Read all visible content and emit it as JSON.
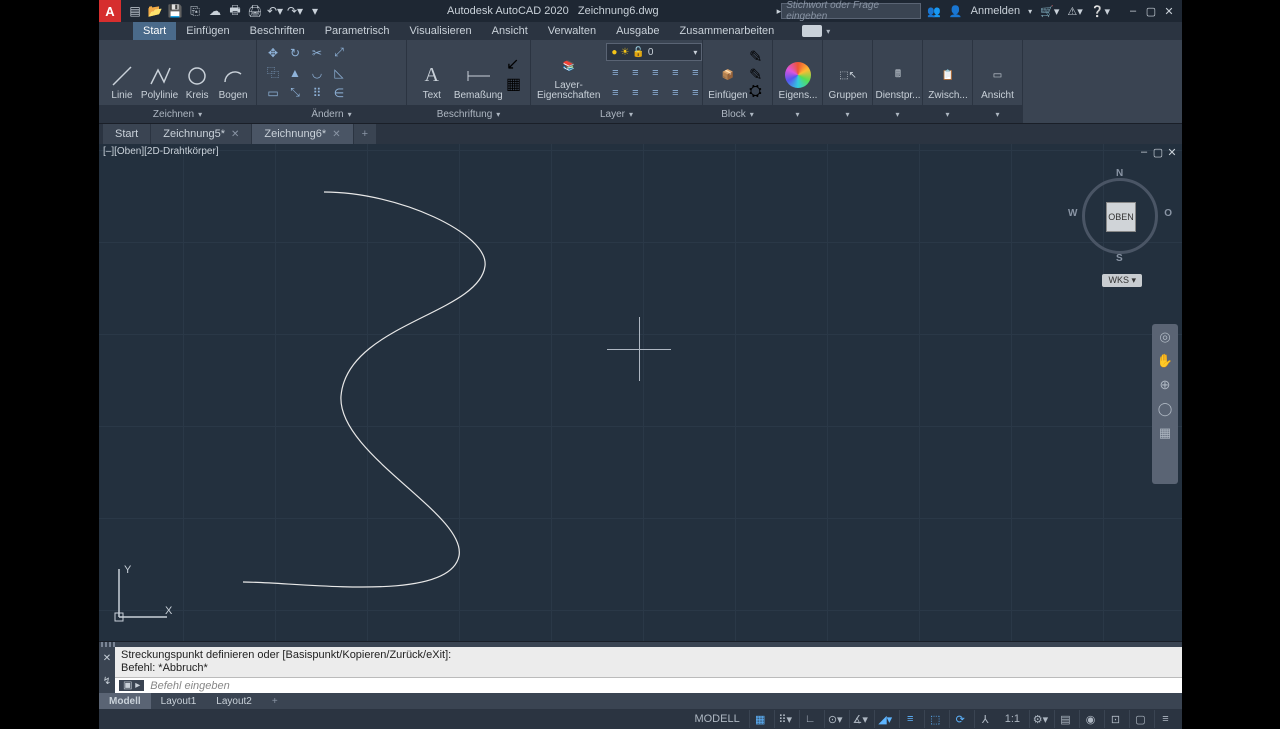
{
  "title": {
    "app": "Autodesk AutoCAD 2020",
    "file": "Zeichnung6.dwg"
  },
  "search": {
    "placeholder": "Stichwort oder Frage eingeben"
  },
  "user": {
    "label": "Anmelden"
  },
  "menu": {
    "items": [
      "Start",
      "Einfügen",
      "Beschriften",
      "Parametrisch",
      "Visualisieren",
      "Ansicht",
      "Verwalten",
      "Ausgabe",
      "Zusammenarbeiten"
    ],
    "active": 0
  },
  "ribbon": {
    "draw": {
      "title": "Zeichnen",
      "btns": [
        "Linie",
        "Polylinie",
        "Kreis",
        "Bogen"
      ]
    },
    "modify": {
      "title": "Ändern"
    },
    "annot": {
      "title": "Beschriftung",
      "btns": [
        "Text",
        "Bemaßung"
      ]
    },
    "layer": {
      "title": "Layer",
      "prop": "Layer-\nEigenschaften",
      "current": "0"
    },
    "block": {
      "title": "Block",
      "btn": "Einfügen"
    },
    "props": {
      "title": "Eigens..."
    },
    "groups": {
      "title": "Gruppen"
    },
    "utils": {
      "title": "Dienstpr..."
    },
    "clip": {
      "title": "Zwisch..."
    },
    "view": {
      "title": "Ansicht"
    }
  },
  "filetabs": {
    "start": "Start",
    "tabs": [
      "Zeichnung5*",
      "Zeichnung6*"
    ],
    "active": 1
  },
  "viewport": {
    "label": "[–][Oben][2D-Drahtkörper]",
    "cube": "OBEN",
    "compass": {
      "n": "N",
      "s": "S",
      "w": "W",
      "o": "O"
    },
    "wks": "WKS",
    "ucs": {
      "x": "X",
      "y": "Y"
    }
  },
  "cmd": {
    "hist1": "Streckungspunkt definieren oder [Basispunkt/Kopieren/Zurück/eXit]:",
    "hist2": "Befehl: *Abbruch*",
    "placeholder": "Befehl eingeben"
  },
  "bottom": {
    "tabs": [
      "Modell",
      "Layout1",
      "Layout2"
    ],
    "active": 0
  },
  "status": {
    "model": "MODELL",
    "scale": "1:1"
  }
}
